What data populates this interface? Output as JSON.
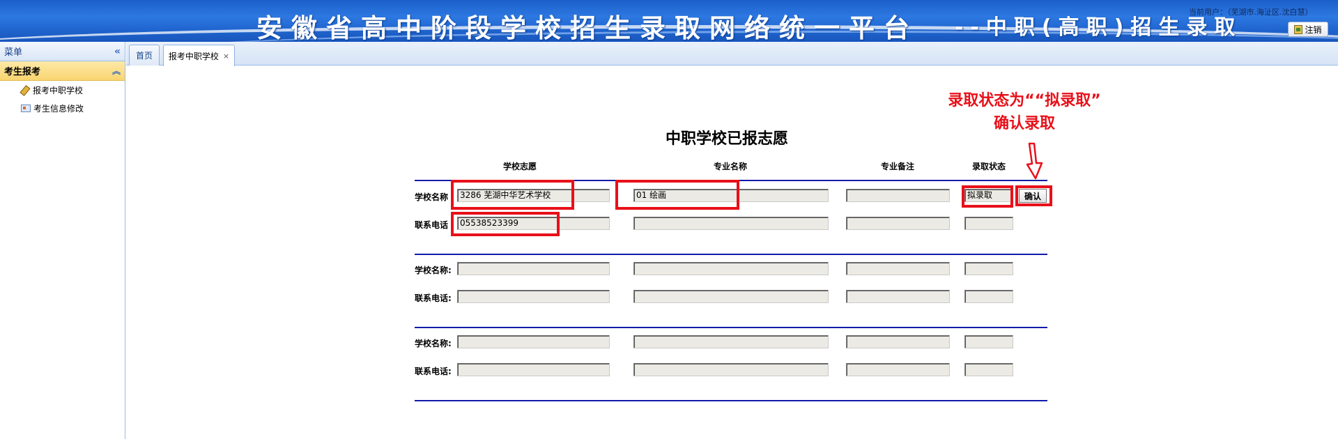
{
  "header": {
    "title": "安徽省高中阶段学校招生录取网络统一平台",
    "subtitle": "--中职(高职)招生录取",
    "current_user_label": "当前用户：（芜湖市.海沚区.沈白慧）",
    "logout_label": "注销"
  },
  "sidebar": {
    "menu_label": "菜单",
    "collapse_icon": "«",
    "group_label": "考生报考",
    "group_icon": "︽",
    "items": [
      {
        "label": "报考中职学校",
        "icon": "pen-icon"
      },
      {
        "label": "考生信息修改",
        "icon": "card-icon"
      }
    ]
  },
  "tabs": [
    {
      "label": "首页"
    },
    {
      "label": "报考中职学校",
      "close": "×"
    }
  ],
  "annotation": {
    "line1": "录取状态为““拟录取”",
    "line2": "确认录取",
    "color": "#e8101a"
  },
  "form": {
    "title": "中职学校已报志愿",
    "columns": [
      "学校志愿",
      "专业名称",
      "专业备注",
      "录取状态"
    ],
    "groups": [
      {
        "school_label": "学校名称",
        "phone_label": "联系电话",
        "school": "3286 芜湖中华艺术学校",
        "major": "01 绘画",
        "major_note": "",
        "status": "拟录取",
        "phone": "05538523399",
        "phone_col2": "",
        "phone_col3": "",
        "phone_col4": ""
      },
      {
        "school_label": "学校名称:",
        "phone_label": "联系电话:",
        "school": "",
        "major": "",
        "major_note": "",
        "status": "",
        "phone": "",
        "phone_col2": "",
        "phone_col3": "",
        "phone_col4": ""
      },
      {
        "school_label": "学校名称:",
        "phone_label": "联系电话:",
        "school": "",
        "major": "",
        "major_note": "",
        "status": "",
        "phone": "",
        "phone_col2": "",
        "phone_col3": "",
        "phone_col4": ""
      }
    ],
    "confirm_label": "确认"
  }
}
